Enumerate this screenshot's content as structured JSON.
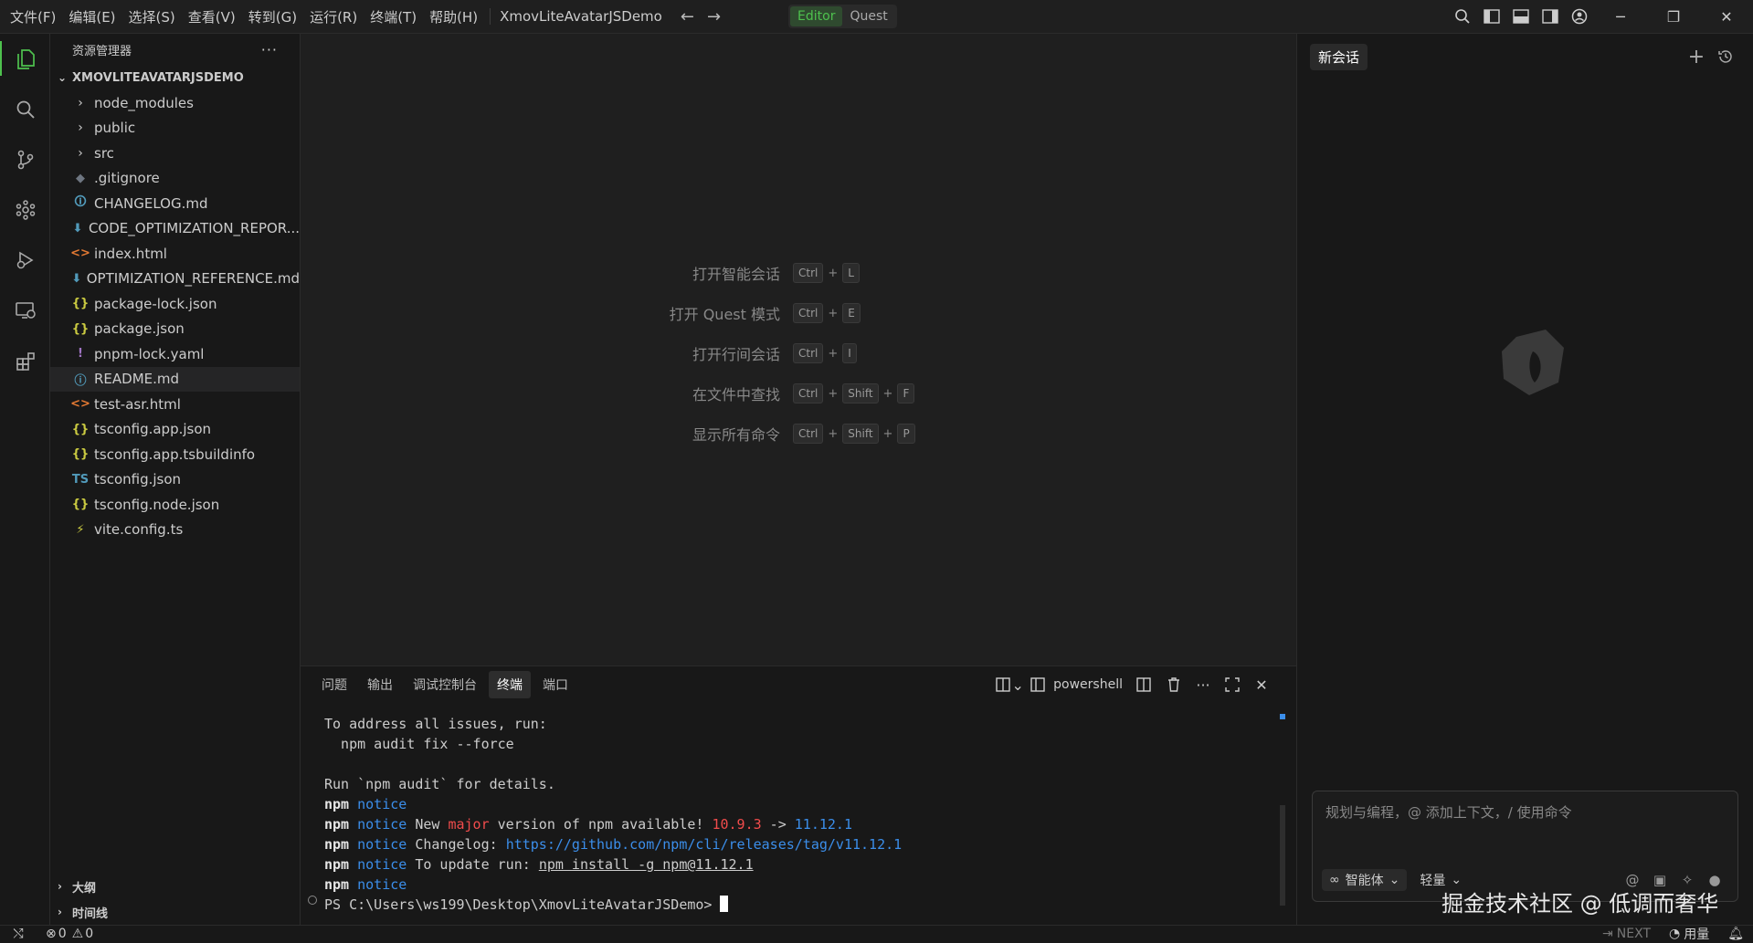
{
  "menu": [
    "文件(F)",
    "编辑(E)",
    "选择(S)",
    "查看(V)",
    "转到(G)",
    "运行(R)",
    "终端(T)",
    "帮助(H)"
  ],
  "title": "XmovLiteAvatarJSDemo",
  "mode": {
    "editor": "Editor",
    "quest": "Quest"
  },
  "sidebar": {
    "title": "资源管理器",
    "more": "···",
    "root": "XMOVLITEAVATARJSDEMO",
    "items": [
      {
        "label": "node_modules",
        "type": "folder"
      },
      {
        "label": "public",
        "type": "folder"
      },
      {
        "label": "src",
        "type": "folder"
      },
      {
        "label": ".gitignore",
        "type": "git",
        "icon": "◆",
        "color": "#6e7681"
      },
      {
        "label": "CHANGELOG.md",
        "type": "file",
        "icon": "🛈",
        "color": "#519aba"
      },
      {
        "label": "CODE_OPTIMIZATION_REPOR...",
        "type": "file",
        "icon": "⬇",
        "color": "#519aba"
      },
      {
        "label": "index.html",
        "type": "file",
        "icon": "<>",
        "color": "#e37933"
      },
      {
        "label": "OPTIMIZATION_REFERENCE.md",
        "type": "file",
        "icon": "⬇",
        "color": "#519aba"
      },
      {
        "label": "package-lock.json",
        "type": "file",
        "icon": "{}",
        "color": "#cbcb41"
      },
      {
        "label": "package.json",
        "type": "file",
        "icon": "{}",
        "color": "#cbcb41"
      },
      {
        "label": "pnpm-lock.yaml",
        "type": "file",
        "icon": "!",
        "color": "#a074c4"
      },
      {
        "label": "README.md",
        "type": "file",
        "icon": "ⓘ",
        "color": "#519aba",
        "selected": true
      },
      {
        "label": "test-asr.html",
        "type": "file",
        "icon": "<>",
        "color": "#e37933"
      },
      {
        "label": "tsconfig.app.json",
        "type": "file",
        "icon": "{}",
        "color": "#cbcb41"
      },
      {
        "label": "tsconfig.app.tsbuildinfo",
        "type": "file",
        "icon": "{}",
        "color": "#cbcb41"
      },
      {
        "label": "tsconfig.json",
        "type": "file",
        "icon": "TS",
        "color": "#519aba"
      },
      {
        "label": "tsconfig.node.json",
        "type": "file",
        "icon": "{}",
        "color": "#cbcb41"
      },
      {
        "label": "vite.config.ts",
        "type": "file",
        "icon": "⚡",
        "color": "#cbcb41"
      }
    ],
    "outline": "大纲",
    "timeline": "时间线"
  },
  "shortcuts": [
    {
      "label": "打开智能会话",
      "keys": [
        "Ctrl",
        "L"
      ]
    },
    {
      "label": "打开 Quest 模式",
      "keys": [
        "Ctrl",
        "E"
      ]
    },
    {
      "label": "打开行间会话",
      "keys": [
        "Ctrl",
        "I"
      ]
    },
    {
      "label": "在文件中查找",
      "keys": [
        "Ctrl",
        "Shift",
        "F"
      ]
    },
    {
      "label": "显示所有命令",
      "keys": [
        "Ctrl",
        "Shift",
        "P"
      ]
    }
  ],
  "panel": {
    "tabs": [
      "问题",
      "输出",
      "调试控制台",
      "终端",
      "端口"
    ],
    "active_tab": "终端",
    "shell": "powershell",
    "terminal": {
      "l1": "To address all issues, run:",
      "l2": "  npm audit fix --force",
      "l3": "Run `npm audit` for details.",
      "npm": "npm",
      "notice": "notice",
      "l5_a": " New ",
      "l5_major": "major",
      "l5_b": " version of npm available! ",
      "l5_old": "10.9.3",
      "l5_arrow": " -> ",
      "l5_new": "11.12.1",
      "l6_a": " Changelog: ",
      "l6_link": "https://github.com/npm/cli/releases/tag/v11.12.1",
      "l7_a": " To update run: ",
      "l7_cmd": "npm install -g npm@11.12.1",
      "prompt": "PS C:\\Users\\ws199\\Desktop\\XmovLiteAvatarJSDemo> "
    }
  },
  "chat": {
    "tab": "新会话",
    "placeholder": "规划与编程，@ 添加上下文，/ 使用命令",
    "agent": "智能体",
    "mode": "轻量"
  },
  "status": {
    "errors": "0",
    "warnings": "0",
    "next": "NEXT",
    "usage": "用量"
  },
  "watermark": "掘金技术社区 @ 低调而奢华"
}
